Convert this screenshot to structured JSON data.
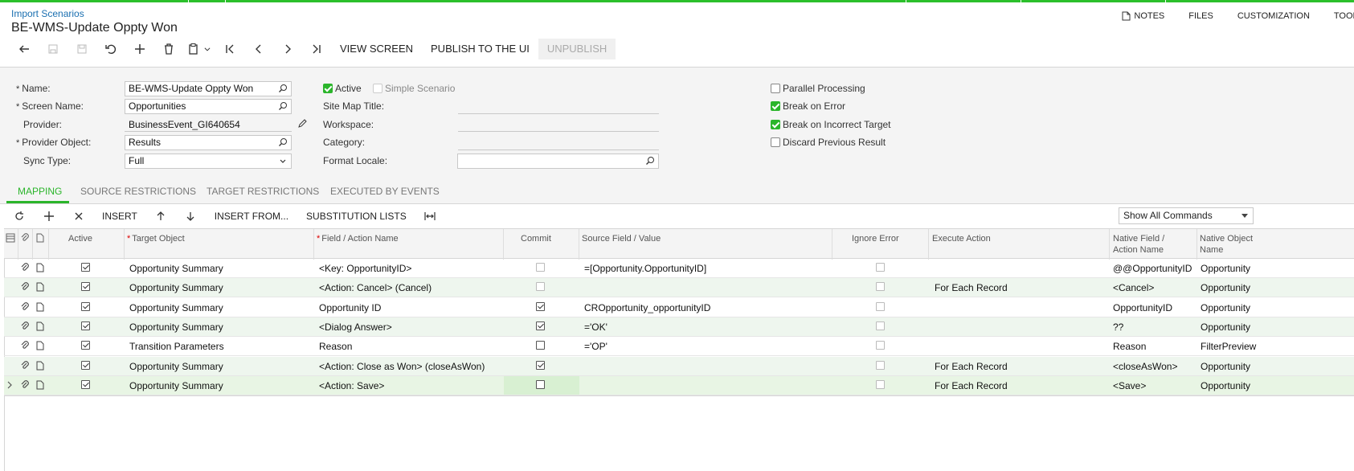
{
  "header": {
    "breadcrumb": "Import Scenarios",
    "title": "BE-WMS-Update Oppty Won",
    "links": [
      "NOTES",
      "FILES",
      "CUSTOMIZATION",
      "TOOLS"
    ]
  },
  "toolbar": {
    "view_screen": "VIEW SCREEN",
    "publish": "PUBLISH TO THE UI",
    "unpublish": "UNPUBLISH"
  },
  "form": {
    "name_label": "Name:",
    "name_value": "BE-WMS-Update Oppty Won",
    "screen_label": "Screen Name:",
    "screen_value": "Opportunities",
    "provider_label": "Provider:",
    "provider_value": "BusinessEvent_GI640654",
    "provider_object_label": "Provider Object:",
    "provider_object_value": "Results",
    "sync_label": "Sync Type:",
    "sync_value": "Full",
    "active_label": "Active",
    "simple_label": "Simple Scenario",
    "sitemap_label": "Site Map Title:",
    "workspace_label": "Workspace:",
    "category_label": "Category:",
    "locale_label": "Format Locale:",
    "parallel_label": "Parallel Processing",
    "break_error_label": "Break on Error",
    "break_target_label": "Break on Incorrect Target",
    "discard_label": "Discard Previous Result",
    "active": true,
    "simple": false,
    "parallel": false,
    "break_error": true,
    "break_target": true,
    "discard": false
  },
  "tabs": [
    "MAPPING",
    "SOURCE RESTRICTIONS",
    "TARGET RESTRICTIONS",
    "EXECUTED BY EVENTS"
  ],
  "grid_toolbar": {
    "insert": "INSERT",
    "insert_from": "INSERT FROM...",
    "substitution": "SUBSTITUTION LISTS",
    "filter_value": "Show All Commands"
  },
  "columns": {
    "active": "Active",
    "target_object": "Target Object",
    "field_action": "Field / Action Name",
    "commit": "Commit",
    "source_field": "Source Field / Value",
    "ignore_error": "Ignore Error",
    "execute_action": "Execute Action",
    "native_field_1": "Native Field /",
    "native_field_2": "Action Name",
    "native_object_1": "Native Object",
    "native_object_2": "Name"
  },
  "rows": [
    {
      "active": true,
      "target": "Opportunity Summary",
      "field": "<Key: OpportunityID>",
      "commit": false,
      "commit_dim": true,
      "source": "=[Opportunity.OpportunityID]",
      "ignore": false,
      "execute": "",
      "native_field": "@@OpportunityID",
      "native_object": "Opportunity"
    },
    {
      "active": true,
      "target": "Opportunity Summary",
      "field": "<Action: Cancel> (Cancel)",
      "commit": false,
      "commit_dim": true,
      "source": "",
      "ignore": false,
      "execute": "For Each Record",
      "native_field": "<Cancel>",
      "native_object": "Opportunity"
    },
    {
      "active": true,
      "target": "Opportunity Summary",
      "field": "Opportunity ID",
      "commit": true,
      "commit_dim": false,
      "source": "CROpportunity_opportunityID",
      "ignore": false,
      "execute": "",
      "native_field": "OpportunityID",
      "native_object": "Opportunity"
    },
    {
      "active": true,
      "target": "Opportunity Summary",
      "field": "<Dialog Answer>",
      "commit": true,
      "commit_dim": false,
      "source": "='OK'",
      "ignore": false,
      "execute": "",
      "native_field": "??",
      "native_object": "Opportunity"
    },
    {
      "active": true,
      "target": "Transition Parameters",
      "field": "Reason",
      "commit": false,
      "commit_dim": false,
      "source": "='OP'",
      "ignore": false,
      "execute": "",
      "native_field": "Reason",
      "native_object": "FilterPreview"
    },
    {
      "active": true,
      "target": "Opportunity Summary",
      "field": "<Action: Close as Won> (closeAsWon)",
      "commit": true,
      "commit_dim": false,
      "source": "",
      "ignore": false,
      "execute": "For Each Record",
      "native_field": "<closeAsWon>",
      "native_object": "Opportunity"
    },
    {
      "active": true,
      "target": "Opportunity Summary",
      "field": "<Action: Save>",
      "commit": false,
      "commit_dim": false,
      "source": "",
      "ignore": false,
      "execute": "For Each Record",
      "native_field": "<Save>",
      "native_object": "Opportunity"
    }
  ]
}
